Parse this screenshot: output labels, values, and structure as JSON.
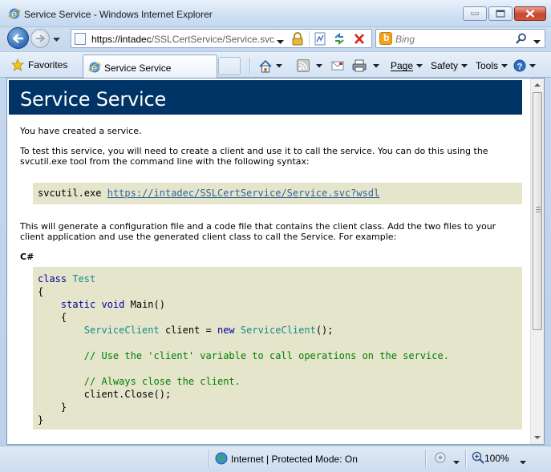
{
  "window": {
    "title": "Service Service - Windows Internet Explorer"
  },
  "navigation": {
    "address_prefix": "https://intadec",
    "address_rest": "/SSLCertService/Service.svc",
    "search_placeholder": "Bing"
  },
  "command_bar": {
    "favorites_label": "Favorites",
    "tab_title": "Service Service",
    "page_label": "Page",
    "safety_label": "Safety",
    "tools_label": "Tools"
  },
  "content": {
    "heading": "Service Service",
    "intro": "You have created a service.",
    "test_instructions": "To test this service, you will need to create a client and use it to call the service. You can do this using the svcutil.exe tool from the command line with the following syntax:",
    "svcutil_command": "svcutil.exe",
    "wsdl_link": "https://intadec/SSLCertService/Service.svc?wsdl",
    "generate_instructions": "This will generate a configuration file and a code file that contains the client class. Add the two files to your client application and use the generated client class to call the Service. For example:",
    "language_label": "C#",
    "code": {
      "l1_kw": "class",
      "l1_type": "Test",
      "l2": "{",
      "l3_kw": "static void",
      "l3_rest": "Main()",
      "l4": "{",
      "l5_type": "ServiceClient",
      "l5_mid": "client =",
      "l5_kw": "new",
      "l5_type2": "ServiceClient",
      "l5_end": "();",
      "l7_comment": "// Use the 'client' variable to call operations on the service.",
      "l9_comment": "// Always close the client.",
      "l10": "client.Close();",
      "l11": "}",
      "l12": "}"
    }
  },
  "status_bar": {
    "zone": "Internet | Protected Mode: On",
    "zoom": "100%"
  }
}
